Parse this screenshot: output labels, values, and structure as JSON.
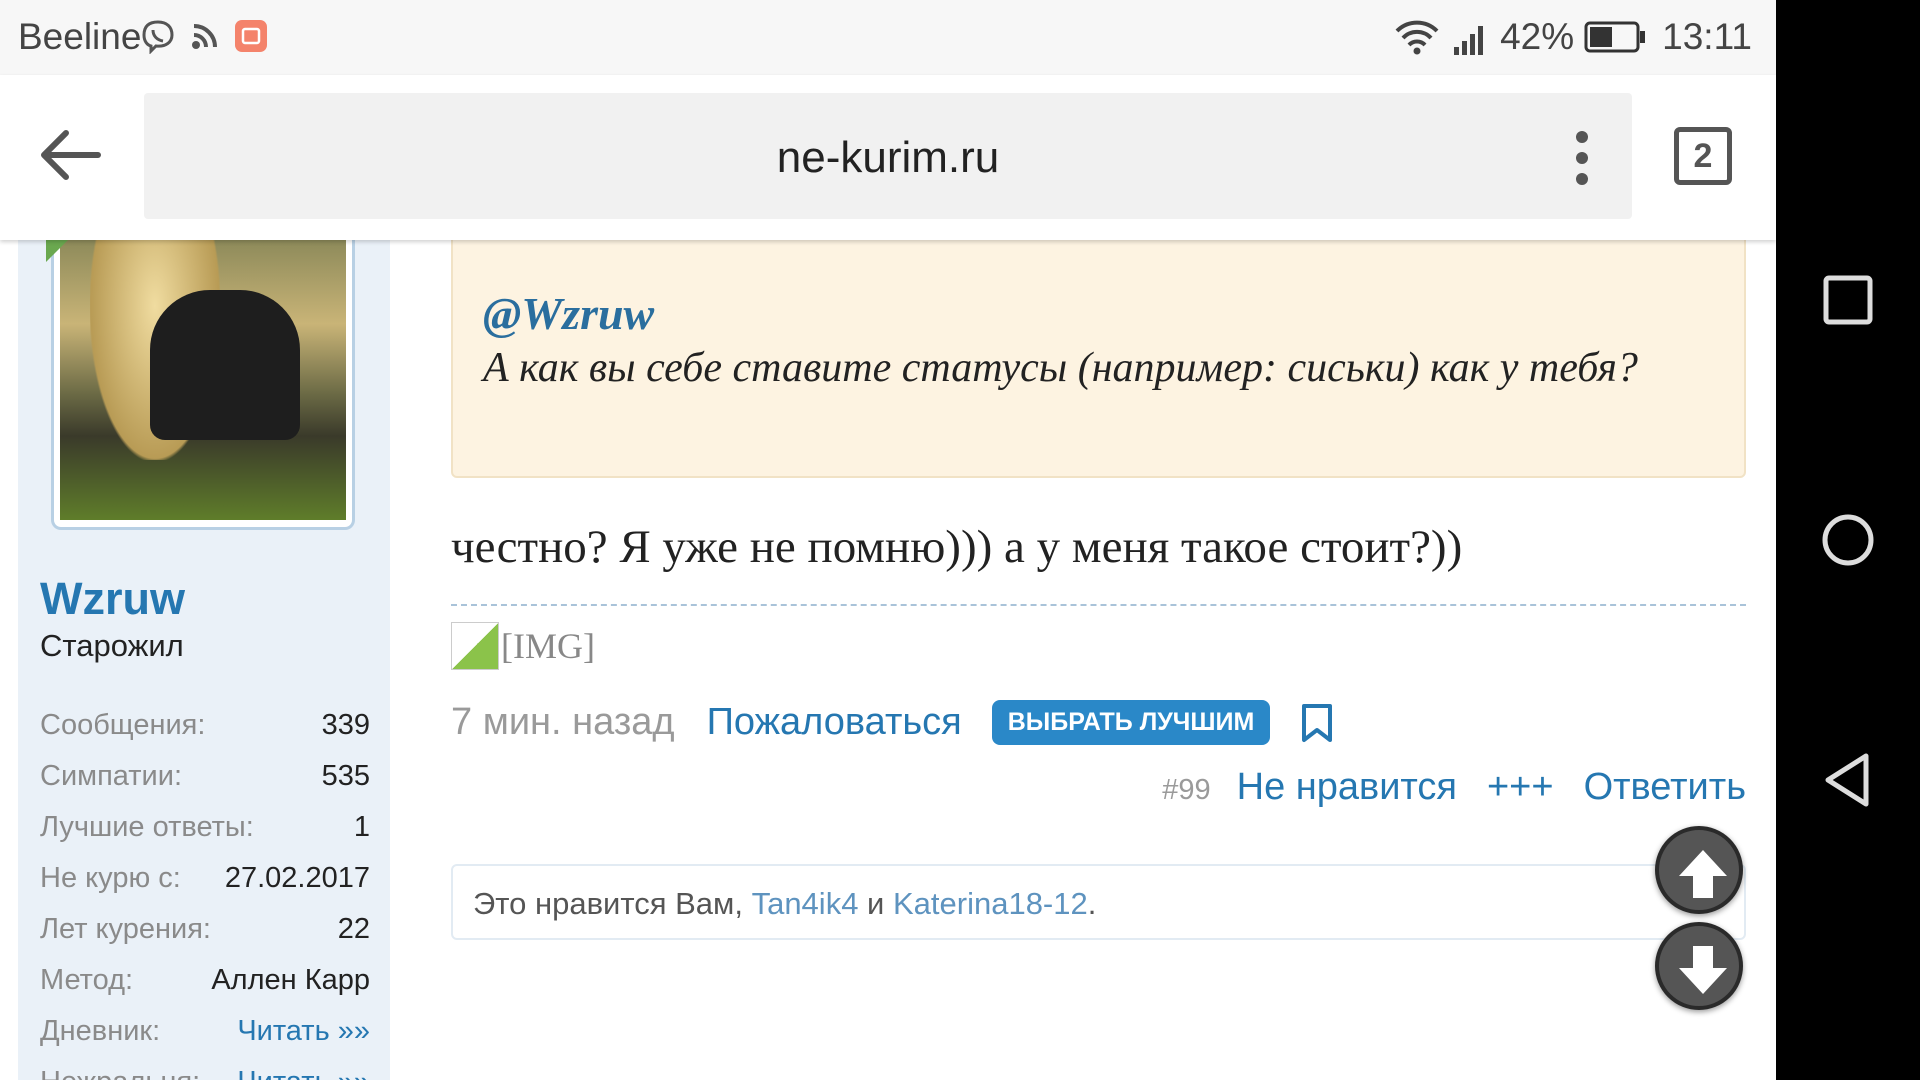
{
  "status_bar": {
    "carrier": "Beeline",
    "battery_percent": "42%",
    "time": "13:11"
  },
  "browser": {
    "url": "ne-kurim.ru",
    "tab_count": "2"
  },
  "sidebar": {
    "username": "Wzruw",
    "user_title": "Старожил",
    "stats": [
      {
        "label": "Сообщения:",
        "value": "339"
      },
      {
        "label": "Симпатии:",
        "value": "535"
      },
      {
        "label": "Лучшие ответы:",
        "value": "1"
      },
      {
        "label": "Не курю с:",
        "value": "27.02.2017"
      },
      {
        "label": "Лет курения:",
        "value": "22"
      },
      {
        "label": "Метод:",
        "value": "Аллен Карр"
      },
      {
        "label": "Дневник:",
        "value": "Читать »»"
      },
      {
        "label": "Нежральня:",
        "value": "Читать »»"
      }
    ]
  },
  "post": {
    "quote_user": "@Wzruw",
    "quote_text": "А как вы себе ставите статусы (например: сиськи) как у тебя?",
    "text": "честно? Я уже не помню))) а у меня такое стоит?))",
    "image_alt": "[IMG]",
    "time": "7 мин. назад",
    "report_label": "Пожаловаться",
    "best_answer_label": "ВЫБРАТЬ ЛУЧШИМ",
    "post_number": "#99",
    "unlike_label": "Не нравится",
    "plus_label": "+++",
    "reply_label": "Ответить",
    "likes_prefix": "Это нравится Вам, ",
    "likes_user1": "Tan4ik4",
    "likes_and": " и ",
    "likes_user2": "Katerina18-12",
    "likes_suffix": "."
  },
  "colors": {
    "link": "#2577b1",
    "quote_bg": "#fdf3e1",
    "sidebar_bg": "#eaf1f8",
    "button": "#2a88c8"
  }
}
